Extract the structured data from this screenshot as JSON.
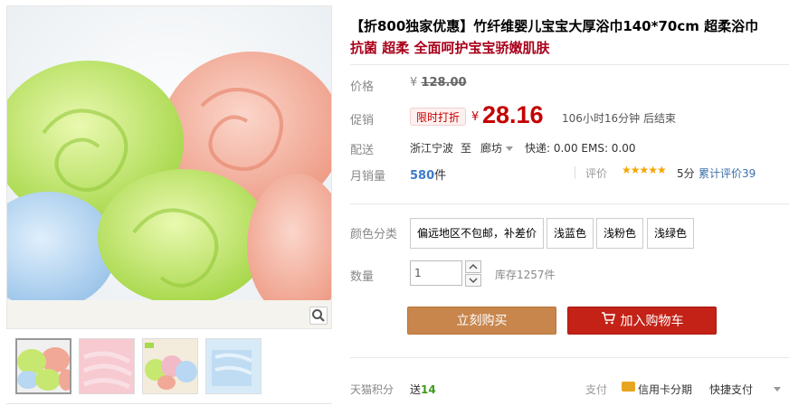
{
  "product": {
    "title": "【折800独家优惠】竹纤维婴儿宝宝大厚浴巾140*70cm 超柔浴巾",
    "subtitle": "抗菌 超柔 全面呵护宝宝骄嫩肌肤"
  },
  "price": {
    "label": "价格",
    "currency": "¥",
    "original": "128.00"
  },
  "promo": {
    "label": "促销",
    "tag": "限时打折",
    "currency": "¥",
    "price": "28.16",
    "countdown": "106小时16分钟 后结束"
  },
  "shipping": {
    "label": "配送",
    "from": "浙江宁波",
    "to_word": "至",
    "destination": "廊坊",
    "fees": "快递: 0.00 EMS: 0.00"
  },
  "sales": {
    "label": "月销量",
    "count": "580",
    "unit": "件"
  },
  "rating": {
    "label": "评价",
    "stars": "★★★★★",
    "score": "5分",
    "reviews_link": "累计评价39"
  },
  "sku": {
    "label": "颜色分类",
    "options": [
      "偏远地区不包邮，补差价",
      "浅蓝色",
      "浅粉色",
      "浅绿色"
    ]
  },
  "quantity": {
    "label": "数量",
    "value": "1",
    "stock": "库存1257件"
  },
  "actions": {
    "buy_now": "立刻购买",
    "add_cart": "加入购物车"
  },
  "points": {
    "label": "天猫积分",
    "prefix": "送",
    "value": "14"
  },
  "payment": {
    "label": "支付",
    "credit": "信用卡分期",
    "quick": "快捷支付"
  },
  "colors": {
    "price_red": "#c40000",
    "buy_button": "#c8864c",
    "cart_button": "#c42217",
    "link_blue": "#3c6ea8"
  }
}
